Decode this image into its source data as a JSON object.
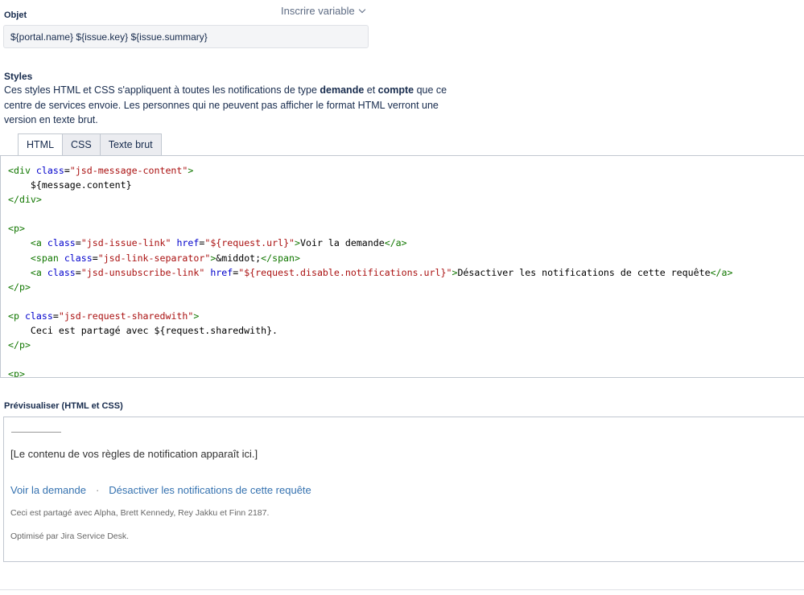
{
  "subject": {
    "label": "Objet",
    "insert_variable": "Inscrire variable",
    "value": "${portal.name} ${issue.key} ${issue.summary}"
  },
  "styles": {
    "heading": "Styles",
    "desc_part1": "Ces styles HTML et CSS s'appliquent à toutes les notifications de type ",
    "desc_bold1": "demande",
    "desc_part2": " et ",
    "desc_bold2": "compte",
    "desc_part3": " que ce centre de services envoie. Les personnes qui ne peuvent pas afficher le format HTML verront une version en texte brut."
  },
  "tabs": [
    {
      "label": "HTML",
      "active": true
    },
    {
      "label": "CSS",
      "active": false
    },
    {
      "label": "Texte brut",
      "active": false
    }
  ],
  "code_lines": [
    "<div class=\"jsd-message-content\">",
    "    ${message.content}",
    "</div>",
    "",
    "<p>",
    "    <a class=\"jsd-issue-link\" href=\"${request.url}\">Voir la demande</a>",
    "    <span class=\"jsd-link-separator\">&middot;</span>",
    "    <a class=\"jsd-unsubscribe-link\" href=\"${request.disable.notifications.url}\">Désactiver les notifications de cette requête</a>",
    "</p>",
    "",
    "<p class=\"jsd-request-sharedwith\">",
    "    Ceci est partagé avec ${request.sharedwith}.",
    "</p>",
    "",
    "<p>"
  ],
  "preview": {
    "label": "Prévisualiser (HTML et CSS)",
    "content": "[Le contenu de vos règles de notification apparaît ici.]",
    "link_view": "Voir la demande",
    "separator": "·",
    "link_unsubscribe": "Désactiver les notifications de cette requête",
    "shared_with": "Ceci est partagé avec Alpha, Brett Kennedy, Rey Jakku et Finn 2187.",
    "powered_by": "Optimisé par Jira Service Desk."
  },
  "colors": {
    "link": "#3572b0",
    "code_tag": "#117700",
    "code_attr": "#0000cc",
    "code_string": "#aa1111"
  }
}
